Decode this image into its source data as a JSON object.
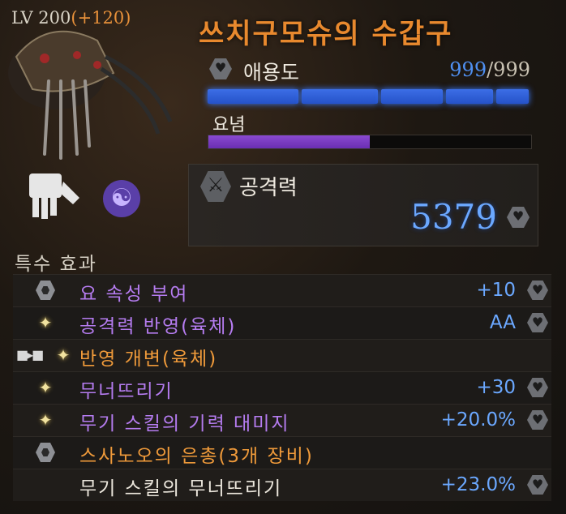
{
  "item": {
    "level_prefix": "LV 200",
    "level_bonus": "(+120)",
    "name": "쓰치구모슈의 수갑구"
  },
  "affinity": {
    "label": "애용도",
    "current": "999",
    "max": "/999",
    "fill_fraction": 1.0,
    "icon": "heart-hex-icon"
  },
  "yonen": {
    "label": "요념",
    "fill_fraction": 0.5
  },
  "attack": {
    "label": "공격력",
    "value": "5379",
    "icon": "sword-hex-icon"
  },
  "special": {
    "title": "특수 효과",
    "effects": [
      {
        "name": "요 속성 부여",
        "value": "+10",
        "icon": "hex-gem-icon",
        "color": "#b57cf0"
      },
      {
        "name": "공격력 반영(육체)",
        "value": "AA",
        "icon": "sparkle-icon",
        "color": "#b57cf0"
      },
      {
        "name": "반영 개변(육체)",
        "value": "",
        "icon": "sparkle-icon",
        "color": "#ef9a3a",
        "linked": true
      },
      {
        "name": "무너뜨리기",
        "value": "+30",
        "icon": "sparkle-icon",
        "color": "#b57cf0"
      },
      {
        "name": "무기 스킬의 기력 대미지",
        "value": "+20.0%",
        "icon": "sparkle-icon",
        "color": "#b57cf0"
      },
      {
        "name": "스사노오의 은총(3개 장비)",
        "value": "",
        "icon": "hex-gem-icon",
        "color": "#ef9a3a"
      },
      {
        "name": "무기 스킬의 무너뜨리기",
        "value": "+23.0%",
        "icon": "",
        "color": "#ece7dd"
      }
    ]
  },
  "colors": {
    "title": "#e8892e",
    "value_blue": "#6ba8ff",
    "affinity_bar": "#3c6ee6",
    "yonen_bar": "#7a3ec4"
  }
}
